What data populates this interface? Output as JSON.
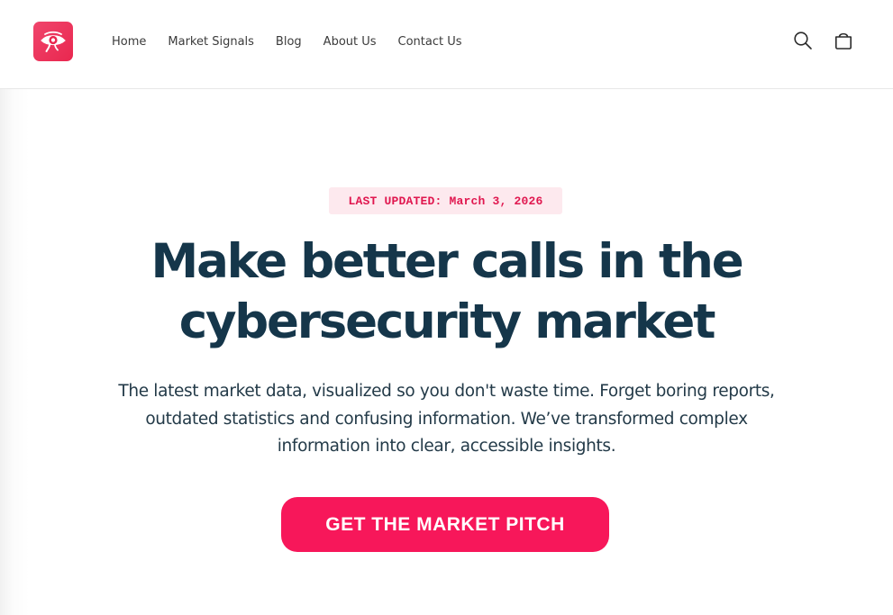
{
  "header": {
    "logo_icon": "eye-logo-icon",
    "nav": [
      {
        "label": "Home"
      },
      {
        "label": "Market Signals"
      },
      {
        "label": "Blog"
      },
      {
        "label": "About Us"
      },
      {
        "label": "Contact Us"
      }
    ],
    "search_icon": "search-icon",
    "cart_icon": "cart-icon"
  },
  "hero": {
    "badge": "LAST UPDATED: March 3, 2026",
    "headline": "Make better calls in the cybersecurity market",
    "subtext": "The latest market data, visualized so you don't waste time. Forget boring reports, outdated statistics and confusing information. We’ve transformed complex information into clear, accessible insights.",
    "cta_label": "GET THE MARKET PITCH"
  },
  "colors": {
    "accent": "#f7175a",
    "logo_bg": "#e9274f",
    "headline": "#15364a",
    "badge_bg": "#fde9ee",
    "badge_text": "#e0174f"
  }
}
